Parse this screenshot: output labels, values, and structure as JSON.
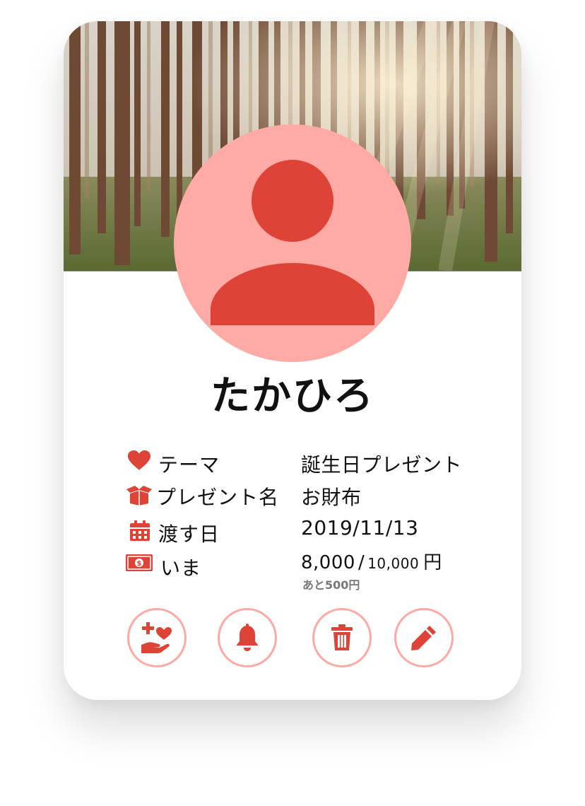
{
  "profile": {
    "name": "たかひろ"
  },
  "details": {
    "theme": {
      "label": "テーマ",
      "value": "誕生日プレゼント",
      "icon": "heart-icon"
    },
    "gift": {
      "label": "プレゼント名",
      "value": "お財布",
      "icon": "open-box-icon"
    },
    "date": {
      "label": "渡す日",
      "value": "2019/11/13",
      "icon": "calendar-icon"
    },
    "money": {
      "label": "いま",
      "icon": "money-bill-icon",
      "current": "8,000",
      "separator": "/",
      "target": "10,000",
      "unit": "円",
      "remaining": "あと500円"
    }
  },
  "actions": [
    {
      "name": "donate-button",
      "icon": "hand-heart-plus-icon"
    },
    {
      "name": "notify-button",
      "icon": "bell-icon"
    },
    {
      "name": "delete-button",
      "icon": "trash-icon"
    },
    {
      "name": "edit-button",
      "icon": "pencil-icon"
    }
  ],
  "colors": {
    "accent": "#dd4337",
    "avatar_background": "#ffaaa5",
    "button_border": "#ffa9a4",
    "text": "#111111",
    "subtext": "#777777"
  }
}
